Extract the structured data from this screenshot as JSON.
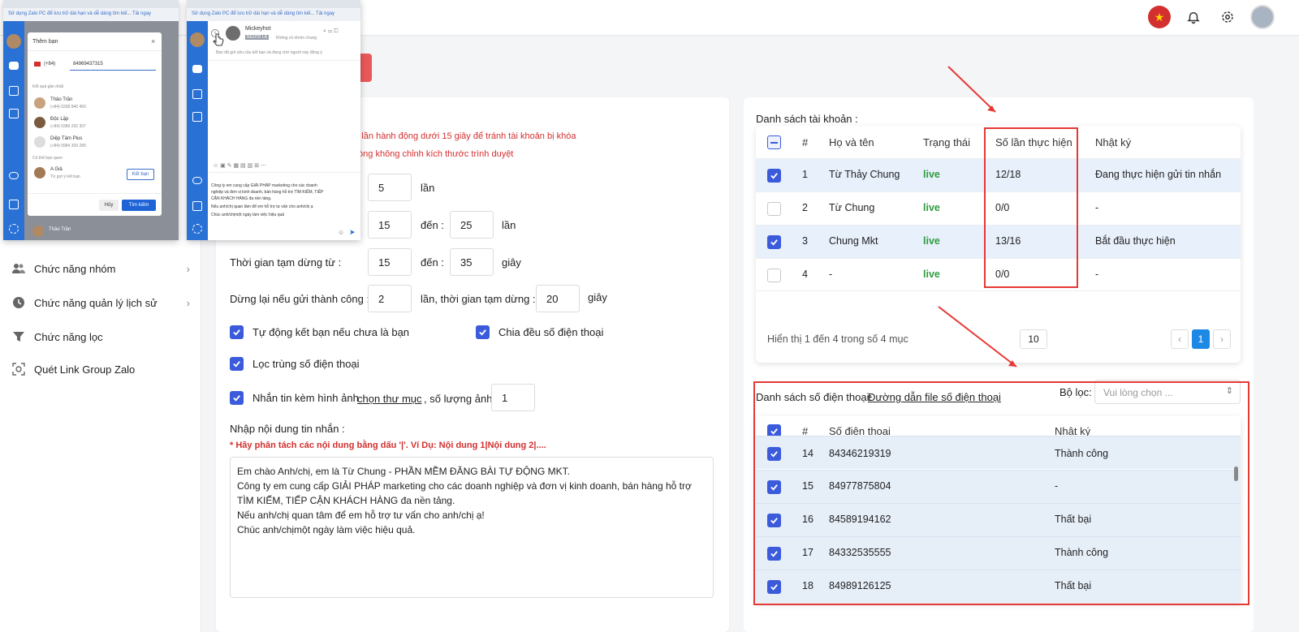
{
  "header": {
    "icons": [
      "vietnam-flag-icon",
      "bell-icon",
      "gear-icon",
      "user-avatar"
    ]
  },
  "sidebar": {
    "items": [
      {
        "label": "Chức năng nhóm",
        "icon": "group-icon"
      },
      {
        "label": "Chức năng quản lý lịch sử",
        "icon": "history-icon"
      },
      {
        "label": "Chức năng lọc",
        "icon": "filter-icon"
      },
      {
        "label": "Quét Link Group Zalo",
        "icon": "scan-icon"
      }
    ]
  },
  "settings": {
    "warning1": "a 2 lần hành động dưới 15 giây để tránh tài khoản bị khóa",
    "warning2": "ui lòng không chỉnh kích thước trình duyệt",
    "row1_value": "5",
    "row1_unit": "lần",
    "row2_from": "15",
    "row2_to_label": "đến :",
    "row2_to": "25",
    "row2_unit": "lần",
    "pause_label": "Thời gian tạm dừng từ :",
    "pause_from": "15",
    "pause_to_label": "đến :",
    "pause_to": "35",
    "pause_unit": "giây",
    "stop_label": "Dừng lại nếu gửi thành công :",
    "stop_count": "2",
    "stop_mid_label": "lần, thời gian tạm dừng :",
    "stop_pause": "20",
    "stop_unit": "giây",
    "auto_friend": "Tự động kết bạn nếu chưa là bạn",
    "split_phones": "Chia đều số điện thoại",
    "dedupe_phones": "Lọc trùng số điện thoại",
    "attach_images": "Nhắn tin kèm hình ảnh",
    "choose_folder": "chọn thư mục",
    "image_count_label": ", số lượng ảnh",
    "image_count": "1",
    "message_label": "Nhập nội dung tin nhắn :",
    "message_hint": "* Hãy phân tách các nội dung bằng dấu '|'. Ví Dụ: Nội dung 1|Nội dung 2|....",
    "message_lines": [
      "Em chào Anh/chị, em là Từ Chung - PHẦN MỀM ĐĂNG BÀI TỰ ĐỘNG MKT.",
      "Công ty em cung cấp GIẢI PHÁP marketing cho các doanh nghiệp và đơn vị kinh doanh, bán hàng hỗ trợ",
      "TÌM KIẾM, TIẾP CẬN KHÁCH HÀNG đa nền tảng.",
      "Nếu anh/chị quan tâm để em hỗ trợ tư vấn cho anh/chị ạ!",
      "Chúc anh/chịmột ngày làm việc hiệu quả."
    ]
  },
  "accounts": {
    "title": "Danh sách tài khoản :",
    "headers": [
      "#",
      "Họ và tên",
      "Trạng thái",
      "Số lần thực hiện",
      "Nhật ký"
    ],
    "rows": [
      {
        "idx": "1",
        "name": "Từ Thảy Chung",
        "status": "live",
        "count": "12/18",
        "log": "Đang thực hiện gửi tin nhắn",
        "checked": true
      },
      {
        "idx": "2",
        "name": "Từ Chung",
        "status": "live",
        "count": "0/0",
        "log": "-",
        "checked": false
      },
      {
        "idx": "3",
        "name": "Chung Mkt",
        "status": "live",
        "count": "13/16",
        "log": "Bắt đầu thực hiện",
        "checked": true
      },
      {
        "idx": "4",
        "name": "-",
        "status": "live",
        "count": "0/0",
        "log": "-",
        "checked": false
      }
    ],
    "footer": "Hiển thị 1 đến 4 trong số 4 mục",
    "page_size": "10",
    "prev": "‹",
    "page": "1",
    "next": "›"
  },
  "phones": {
    "title": "Danh sách số điện thoại:",
    "file_link": "Đường dẫn file số điện thoại",
    "filter_label": "Bộ lọc:",
    "filter_placeholder": "Vui lòng chọn ...",
    "headers": [
      "#",
      "Số điện thoại",
      "Nhật ký"
    ],
    "rows": [
      {
        "idx": "14",
        "phone": "84346219319",
        "log": "Thành công"
      },
      {
        "idx": "15",
        "phone": "84977875804",
        "log": "-"
      },
      {
        "idx": "16",
        "phone": "84589194162",
        "log": "Thất bại"
      },
      {
        "idx": "17",
        "phone": "84332535555",
        "log": "Thành công"
      },
      {
        "idx": "18",
        "phone": "84989126125",
        "log": "Thất bại"
      }
    ]
  },
  "zalo_left": {
    "notice": "Sử dụng Zalo PC để lưu trữ dài hạn và dễ dàng tìm kiế... Tải ngay",
    "dialog_title": "Thêm bạn",
    "country_code": "(+84)",
    "phone": "84969437315",
    "recent_label": "Kết quả gần nhất",
    "contacts": [
      {
        "name": "Thảo Trần",
        "phone": "(+84) 0338 840 450"
      },
      {
        "name": "Độc Lập",
        "phone": "(+84) 0389 292 307"
      },
      {
        "name": "Diệp Tâm Plus",
        "phone": "(+84) 0984 309 289"
      }
    ],
    "maybe_label": "Có thể bạn quen",
    "suggest_name": "A Giả",
    "suggest_sub": "Từ gợi ý kết bạn",
    "add_friend": "Kết bạn",
    "cancel": "Hủy",
    "search": "Tìm kiếm",
    "bottom_name": "Thảo Trần"
  },
  "zalo_right": {
    "notice": "Sử dụng Zalo PC để lưu trữ dài hạn và dễ dàng tìm kiế... Tải ngay",
    "chat_name": "Mickeyhot",
    "tag": "NGƯỜI LẠ",
    "no_group": "Không có nhóm chung",
    "request_note": "Bạn đã gửi yêu cầu kết bạn và đang chờ người này đồng ý",
    "compose_lines": [
      "Công ty em cung cấp GIẢI PHÁP marketing cho các doanh",
      "nghiệp và đơn vị kinh doanh, bán hàng hỗ trợ TÌM KIẾM, TIẾP",
      "CẬN KHÁCH HÀNG đa nền tảng.",
      "Nếu anh/chị quan tâm để em hỗ trợ tư vấn cho anh/chị ạ",
      "Chúc anh/chịmột ngày làm việc hiệu quả"
    ]
  }
}
